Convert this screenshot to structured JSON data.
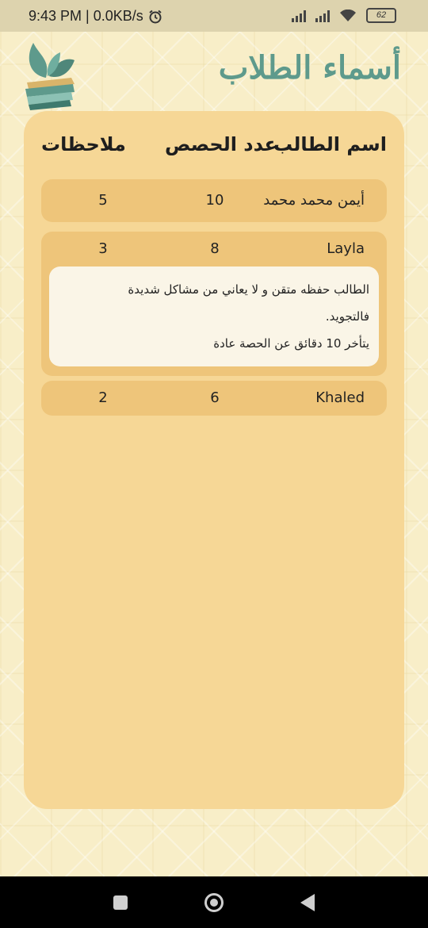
{
  "status": {
    "time_speed": "9:43 PM | 0.0KB/s",
    "battery": "62"
  },
  "header": {
    "title": "أسماء الطلاب"
  },
  "table": {
    "col_name": "اسم الطالب",
    "col_count": "عدد الحصص",
    "col_notes": "ملاحظات",
    "rows": [
      {
        "name": "أيمن محمد محمد",
        "count": "10",
        "notes": "5"
      },
      {
        "name": "Layla",
        "count": "8",
        "notes": "3",
        "note_lines": [
          "الطالب حفظه متقن و لا يعاني من مشاكل شديدة",
          "فالتجويد.",
          "يتأخر 10 دقائق عن الحصة عادة"
        ]
      },
      {
        "name": "Khaled",
        "count": "6",
        "notes": "2"
      }
    ]
  },
  "colors": {
    "title": "#5e9a8c",
    "card": "#f6d796",
    "row": "#eec57a",
    "note_box": "#faf5e7"
  }
}
